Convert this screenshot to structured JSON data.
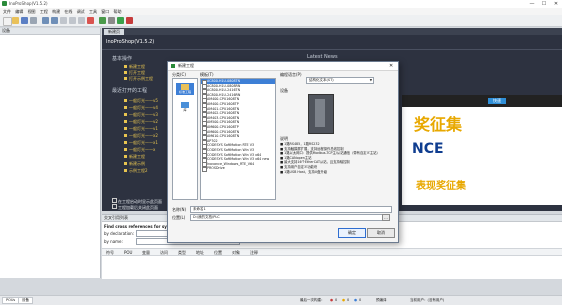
{
  "window": {
    "title": "InoProShop(V1.5.2)",
    "controls": [
      "—",
      "☐",
      "✕"
    ]
  },
  "menu": [
    "文件",
    "编辑",
    "视图",
    "工程",
    "构建",
    "在线",
    "调试",
    "工具",
    "窗口",
    "帮助"
  ],
  "left_panel": {
    "title": "设备"
  },
  "doc_tab": {
    "label": "新建页"
  },
  "start_page": {
    "logo": "InoProShop(V1.5.2)",
    "news_title": "Latest News",
    "basic_ops_title": "基本操作",
    "basic_ops": [
      "新建工程",
      "打开工程",
      "打开示例工程"
    ],
    "recent_title": "最近打开的工程",
    "recent": [
      "一般灯光——v5",
      "一般灯光——v4",
      "一般灯光——v3",
      "一般灯光——v2",
      "一般灯光——v1",
      "一般灯光——x2",
      "一般灯光——x1",
      "一般灯光——x",
      "新建工程",
      "新建示例",
      "示例工程2"
    ],
    "startup_check": "在工程启动时显示此页面",
    "close_check": "工程加载后关闭此页面"
  },
  "news_banner": {
    "t1": "奖征集",
    "t2": "NCE",
    "t3": "表现奖征集",
    "btn": "快速"
  },
  "bottom_panel": {
    "title": "交叉引用列表",
    "subtitle": "Find cross references for symbol",
    "by_declaration": "by declaration:",
    "by_name": "by name:",
    "columns": [
      "符号",
      "POU",
      "变量",
      "访问",
      "类型",
      "地址",
      "位置",
      "对象",
      "注释"
    ]
  },
  "status_bar": {
    "tabs": [
      "POUs",
      "设备"
    ],
    "build_status": "最后一次构建：",
    "errors": "0",
    "warnings": "0",
    "messages": "0",
    "precompile": "预编译",
    "user": "当前用户：(没有用户)"
  },
  "dialog": {
    "title": "新建工程",
    "categories_label": "分类(C)",
    "categories": [
      {
        "label": "标准工程"
      },
      {
        "label": "库"
      }
    ],
    "templates_label": "模板(T)",
    "templates": [
      "AC800-H1U-0808TN",
      "AC800-H1U-0808RN",
      "AC800-H1U-2416TN",
      "AC800-H1U-2416RN",
      "AM400-CPU1608TN",
      "AM400-CPU1608TP",
      "AM401-CPU1608TN",
      "AM402-CPU1608TN",
      "AM403-CPU1608TN",
      "AM500-CPU1608TN",
      "AM600-CPU1608TP",
      "AM600-CPU1608TN",
      "AM610-CPU1608TN",
      "AP702",
      "CODESYS SoftMotion RTE V3",
      "CODESYS SoftMotion Win V3",
      "CODESYS SoftMotion Win V3 x64",
      "CODESYS SoftMotion Win V3 x64 new",
      "Inovance_Windows_RTE_V64",
      "PROSDrive"
    ],
    "selected_template": 0,
    "device_label": "设备",
    "language_label": "编程语言(P)",
    "language": "结构化文本(ST)",
    "explain_label": "说明",
    "explain": [
      "■ 1路RS485，1路RS232",
      "■ 支持触摸屏扩展，支持远程操作总线控制",
      "■ 1路以太网口：提供Modbus-TCP主/从站通信（带有自定义主站）",
      "■ 1路CANopen主站",
      "■ 最大支持16个EtherCAT从站，且支持轴控制",
      "■ 支持用户自定义功能块",
      "■ 1路USB Host，支持U盘升级"
    ],
    "name_label": "名称(N)",
    "name_value": "未命名1",
    "location_label": "位置(L)",
    "location_value": "D:\\我的文档\\PLC",
    "ok": "确定",
    "cancel": "取消"
  },
  "colors": {
    "accent": "#3d7fd6",
    "start_bg": "#2d3240",
    "link": "#e8c550"
  }
}
